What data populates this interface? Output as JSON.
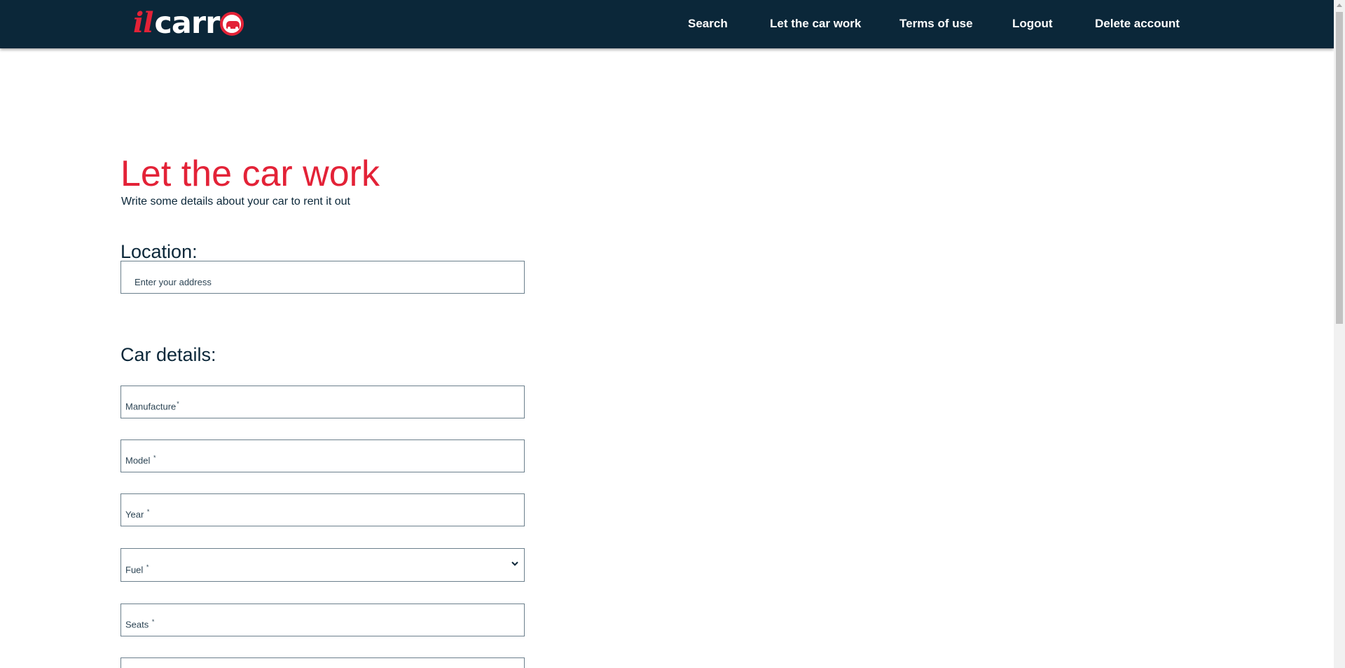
{
  "brand": {
    "logo_il": "il",
    "logo_carr": "carr"
  },
  "nav": {
    "items": [
      "Search",
      "Let the car work",
      "Terms of use",
      "Logout",
      "Delete account"
    ]
  },
  "page": {
    "title": "Let the car work",
    "subtitle": "Write some details about your car to rent it out"
  },
  "location": {
    "label": "Location:",
    "placeholder": "Enter your address"
  },
  "car_details": {
    "label": "Car details:",
    "fields": [
      {
        "label": "Manufacture",
        "required": "*"
      },
      {
        "label": "Model",
        "required": "*"
      },
      {
        "label": "Year",
        "required": "*"
      },
      {
        "label": "Fuel",
        "required": "*"
      },
      {
        "label": "Seats",
        "required": "*"
      }
    ]
  },
  "colors": {
    "navy": "#0b2739",
    "accent": "#e32237"
  },
  "icons": {
    "fuel_select": "chevron-down-icon",
    "logo_badge": "car-icon"
  }
}
